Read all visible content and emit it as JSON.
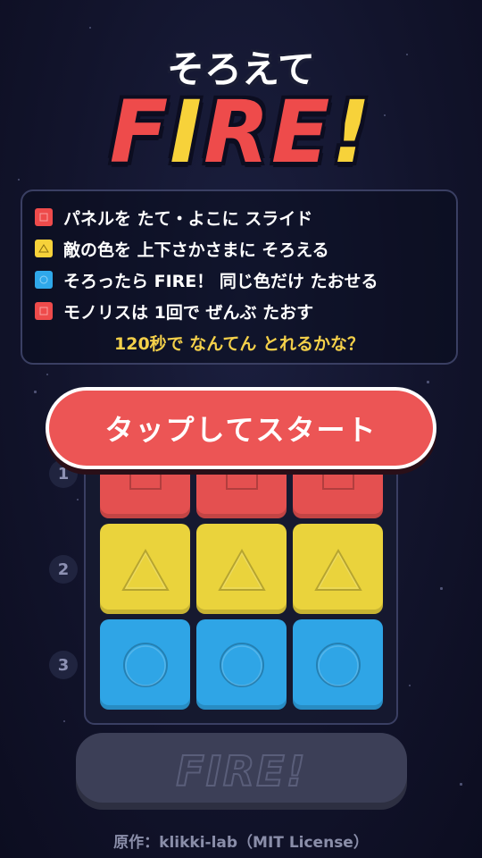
{
  "title": {
    "sub": "そろえて",
    "main": [
      {
        "char": "F",
        "color": "#ee4b4b"
      },
      {
        "char": "I",
        "color": "#f7d23a"
      },
      {
        "char": "R",
        "color": "#ee4b4b"
      },
      {
        "char": "E",
        "color": "#ee4b4b"
      },
      {
        "char": "!",
        "color": "#f7d23a"
      }
    ]
  },
  "rules": {
    "items": [
      {
        "icon": "square-icon",
        "color": "#ee4b4b",
        "text": "パネルを たて・よこに スライド"
      },
      {
        "icon": "triangle-icon",
        "color": "#f7d23a",
        "text": "敵の色を 上下さかさまに そろえる"
      },
      {
        "icon": "circle-icon",
        "color": "#2fa8ea",
        "text": "そろったら FIRE！ 同じ色だけ たおせる"
      },
      {
        "icon": "square-icon",
        "color": "#ee4b4b",
        "text": "モノリスは 1回で ぜんぶ たおす"
      }
    ],
    "footer": "120秒で なんてん とれるかな？"
  },
  "start_button": "タップしてスタート",
  "board": {
    "row_labels": [
      "1",
      "2",
      "3"
    ],
    "rows": [
      {
        "shape": "square",
        "color": "#e45050"
      },
      {
        "shape": "triangle",
        "color": "#ead33c"
      },
      {
        "shape": "circle",
        "color": "#2fa5e6"
      }
    ]
  },
  "fire_button": "FIRE!",
  "credit": "原作：klikki-lab（MIT License）"
}
